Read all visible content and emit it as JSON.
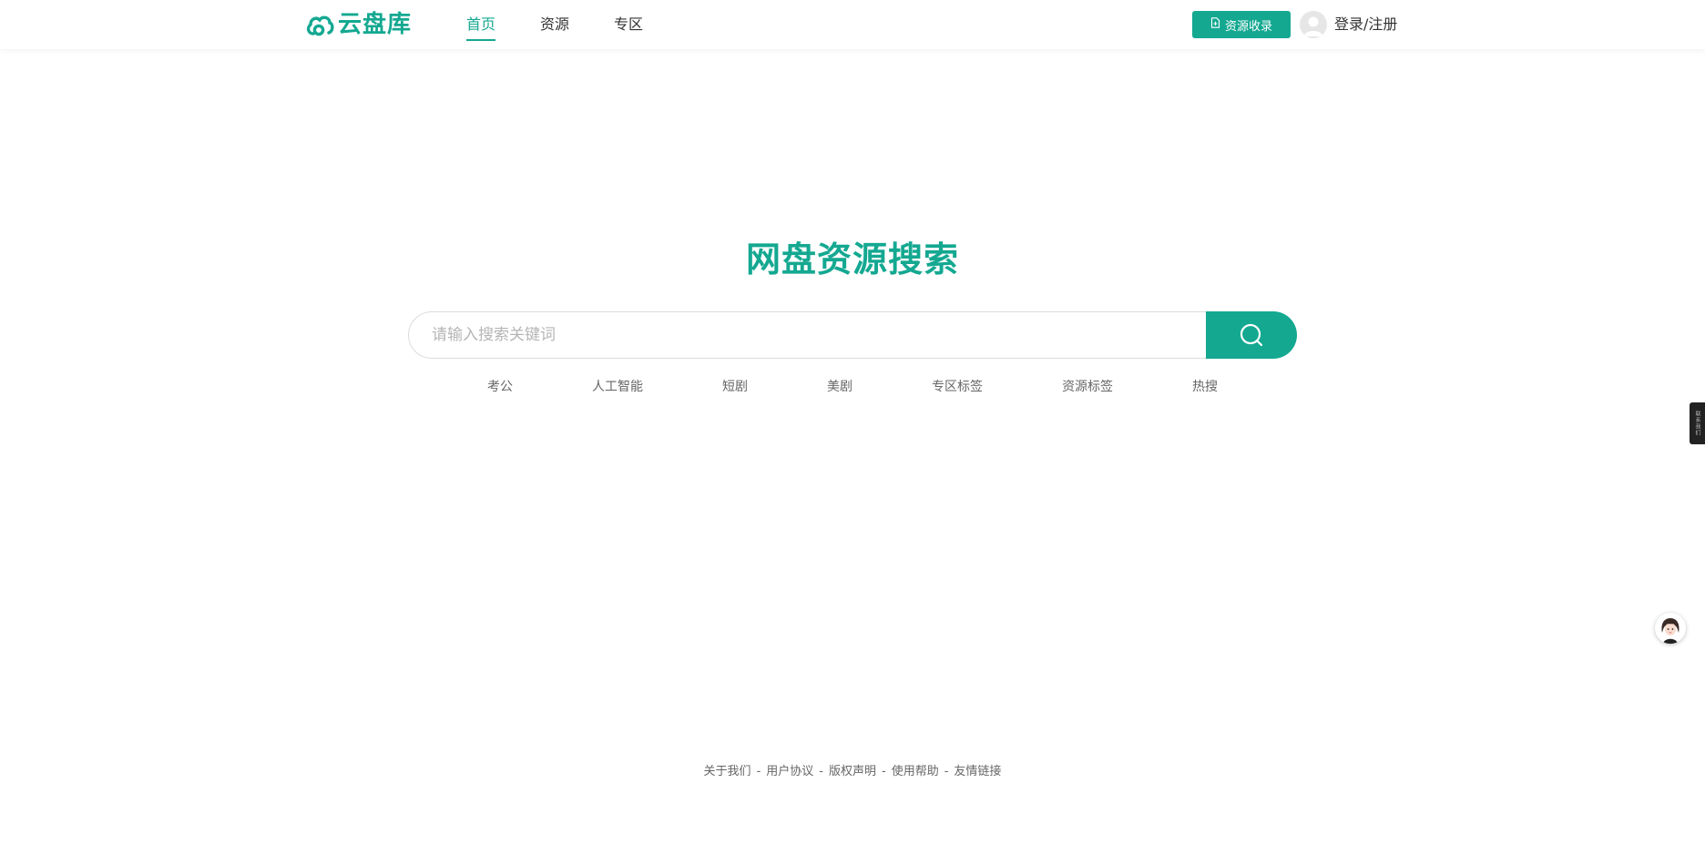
{
  "header": {
    "logo_text": "云盘库",
    "brand_color": "#14a891",
    "nav": [
      {
        "label": "首页",
        "active": true
      },
      {
        "label": "资源",
        "active": false
      },
      {
        "label": "专区",
        "active": false
      }
    ],
    "collect_button": {
      "label": "资源收录",
      "icon": "document-icon"
    },
    "login_label": "登录/注册"
  },
  "main": {
    "title": "网盘资源搜索",
    "search": {
      "placeholder": "请输入搜索关键词",
      "value": "",
      "icon": "search-icon"
    },
    "tags": [
      "考公",
      "人工智能",
      "短剧",
      "美剧",
      "专区标签",
      "资源标签",
      "热搜"
    ]
  },
  "footer": {
    "links": [
      "关于我们",
      "用户协议",
      "版权声明",
      "使用帮助",
      "友情链接"
    ],
    "separator": "-"
  },
  "side": {
    "tab_text": "联系我们",
    "service_icon": "customer-service-avatar-icon"
  }
}
